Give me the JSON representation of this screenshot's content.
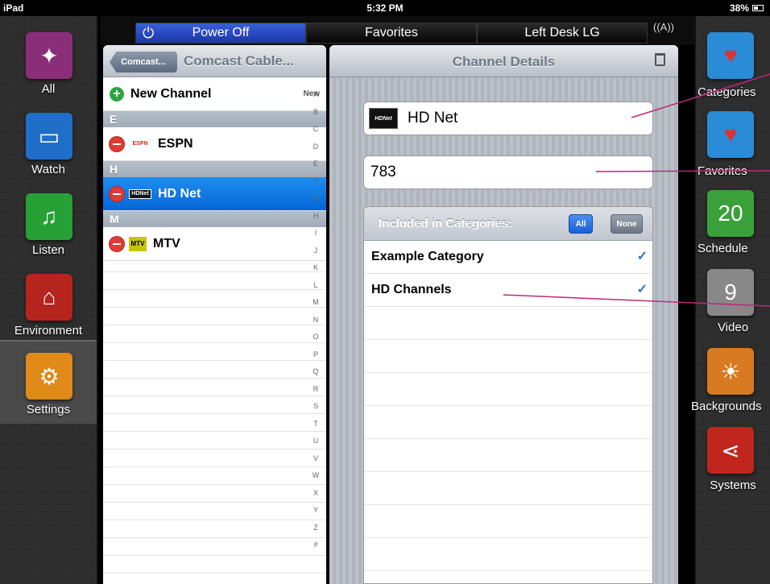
{
  "status": {
    "device": "iPad",
    "time": "5:32 PM",
    "battery": "38%"
  },
  "topbar": {
    "power": "Power Off",
    "favorites": "Favorites",
    "room": "Left Desk LG"
  },
  "left_rail": [
    {
      "label": "All",
      "icon": "compass-icon",
      "color": "#8a2e7a"
    },
    {
      "label": "Watch",
      "icon": "tv-icon",
      "color": "#1f6fc8"
    },
    {
      "label": "Listen",
      "icon": "music-note-icon",
      "color": "#27a035"
    },
    {
      "label": "Environment",
      "icon": "house-icon",
      "color": "#b5241d"
    },
    {
      "label": "Settings",
      "icon": "gears-icon",
      "color": "#e08a1a"
    }
  ],
  "right_rail": [
    {
      "label": "Categories",
      "icon": "heart-icon",
      "color": "#2a8bd6"
    },
    {
      "label": "Favorites",
      "icon": "heart-plus-icon",
      "color": "#2a8bd6"
    },
    {
      "label": "Schedule",
      "icon": "thermometer-calendar-icon",
      "color": "#3aa03a"
    },
    {
      "label": "Video",
      "icon": "film-countdown-icon",
      "color": "#888888"
    },
    {
      "label": "Backgrounds",
      "icon": "sunset-icon",
      "color": "#d87a20"
    },
    {
      "label": "Systems",
      "icon": "share-nodes-icon",
      "color": "#c0261e"
    }
  ],
  "list": {
    "back": "Comcast...",
    "title": "Comcast Cable...",
    "new_channel": "New Channel",
    "new_badge": "New",
    "sections": [
      "E",
      "H",
      "M"
    ],
    "channels": [
      {
        "name": "ESPN",
        "logo": "ESPN"
      },
      {
        "name": "HD Net",
        "logo": "HDNet"
      },
      {
        "name": "MTV",
        "logo": "MTV"
      }
    ],
    "index": [
      "A",
      "B",
      "C",
      "D",
      "E",
      "F",
      "G",
      "H",
      "I",
      "J",
      "K",
      "L",
      "M",
      "N",
      "O",
      "P",
      "Q",
      "R",
      "S",
      "T",
      "U",
      "V",
      "W",
      "X",
      "Y",
      "Z",
      "#"
    ]
  },
  "detail": {
    "title": "Channel Details",
    "channel_name": "HD Net",
    "channel_logo": "HDNet",
    "channel_number": "783",
    "categories_header": "Included in Categories:",
    "all_label": "All",
    "none_label": "None",
    "categories": [
      {
        "name": "Example Category",
        "check": "✓"
      },
      {
        "name": "HD Channels",
        "check": "✓"
      }
    ]
  }
}
